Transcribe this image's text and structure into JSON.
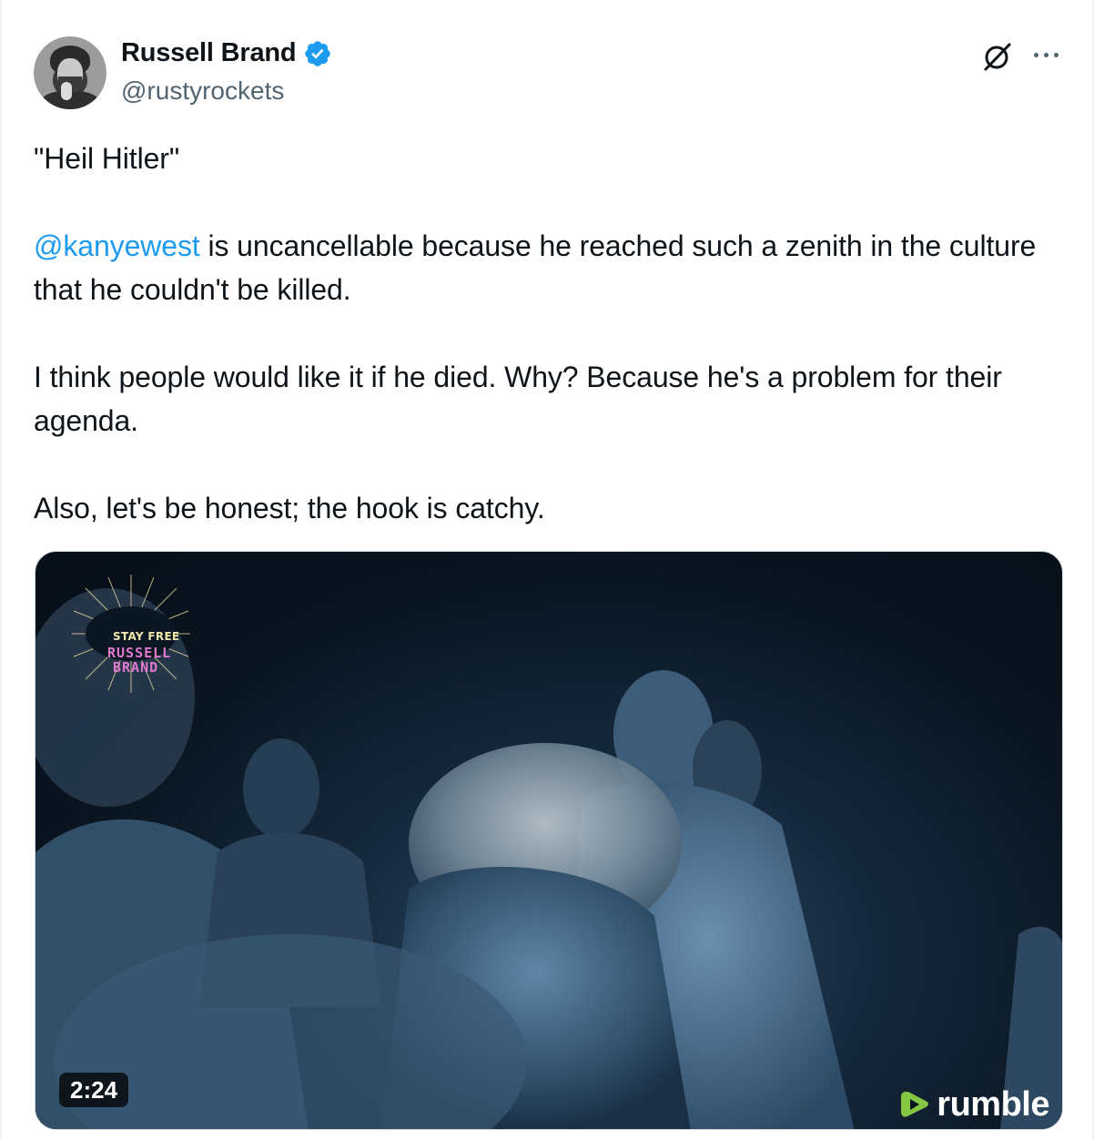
{
  "author": {
    "name": "Russell Brand",
    "handle": "@rustyrockets",
    "verified": true,
    "avatar_icon": "avatar-portrait"
  },
  "actions": {
    "grok_icon": "grok-icon",
    "more_icon": "more-horizontal-icon"
  },
  "tweet": {
    "line_1": "\"Heil Hitler\"",
    "mention": "@kanyewest",
    "para_2_rest": " is uncancellable because he reached such a zenith in the culture that he couldn't be killed.",
    "para_3": "I think people would like it if he died. Why? Because he's a problem for their agenda.",
    "para_4": "Also, let's be honest; the hook is catchy."
  },
  "media": {
    "type": "video",
    "duration": "2:24",
    "watermark_line_1": "STAY FREE",
    "watermark_line_2": "RUSSELL",
    "watermark_line_3": "BRAND",
    "provider": "rumble"
  },
  "colors": {
    "text": "#0f1419",
    "secondary": "#536471",
    "link": "#1d9bf0",
    "verified": "#1d9bf0",
    "rumble_green": "#85c742"
  }
}
